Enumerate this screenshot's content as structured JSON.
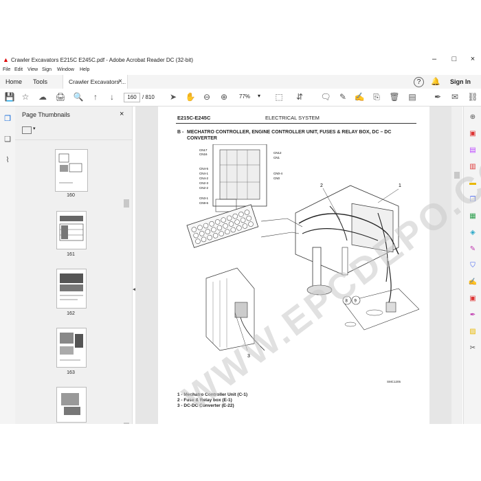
{
  "window": {
    "title": "Crawler Excavators E215C E245C.pdf - Adobe Acrobat Reader DC (32-bit)",
    "controls": [
      "–",
      "□",
      "×"
    ]
  },
  "menu": [
    "File",
    "Edit",
    "View",
    "Sign",
    "Window",
    "Help"
  ],
  "tabs": {
    "home": "Home",
    "tools": "Tools",
    "document": "Crawler Excavators ...",
    "sign_in": "Sign In"
  },
  "toolbar": {
    "page_current": "160",
    "page_total": "/ 810",
    "zoom": "77%"
  },
  "thumbnails": {
    "title": "Page Thumbnails",
    "pages": [
      "160",
      "161",
      "162",
      "163"
    ]
  },
  "document": {
    "header_left": "E215C-E245C",
    "header_center": "ELECTRICAL SYSTEM",
    "section_letter": "B -",
    "section_title_line1": "MECHATRO CONTROLLER, ENGINE CONTROLLER UNIT, FUSES & RELAY BOX, DC – DC",
    "section_title_line2": "CONVERTER",
    "figure_code": "SMC1205",
    "callouts": [
      "1",
      "2",
      "3",
      "8",
      "9"
    ],
    "connector_labels": [
      "CN17",
      "CN16",
      "CN12",
      "CN1",
      "CN4-5",
      "CN4-1",
      "CN4-2",
      "CN2-3",
      "CN2-2",
      "CN0-4",
      "CN0",
      "CN3-1",
      "CN9-6"
    ],
    "legend": [
      "1 - Mechatro Controller Unit (C-1)",
      "2 - Fuse & Relay box (E-1)",
      "3 - DC-DC Converter (E-22)"
    ]
  },
  "watermark": "WWW.EPCDEPO.COM"
}
